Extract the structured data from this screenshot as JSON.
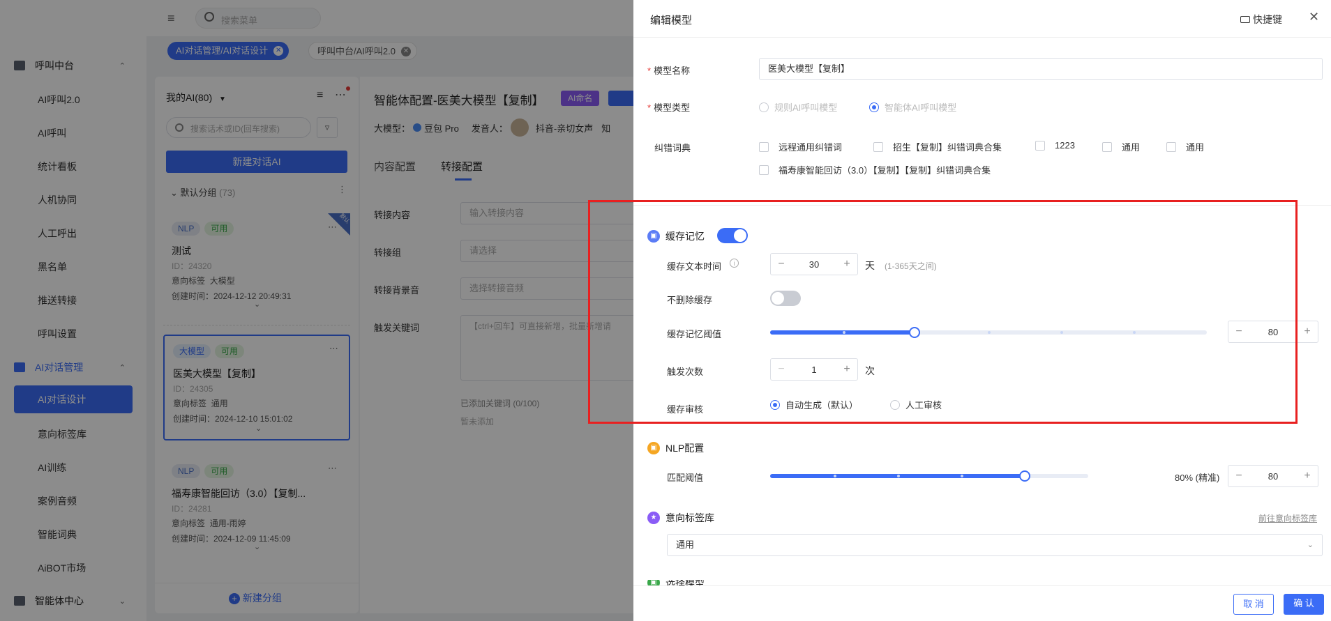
{
  "sidebar": {
    "groups": [
      {
        "label": "呼叫中台",
        "icon": "monitor-icon"
      },
      {
        "label": "AI对话管理",
        "icon": "document-icon"
      },
      {
        "label": "智能体中心",
        "icon": "layers-icon"
      }
    ],
    "items_call": [
      "AI呼叫2.0",
      "AI呼叫",
      "统计看板",
      "人机协同",
      "人工呼出",
      "黑名单",
      "推送转接",
      "呼叫设置"
    ],
    "items_ai": [
      "AI对话设计",
      "意向标签库",
      "AI训练",
      "案例音频",
      "智能词典",
      "AiBOT市场"
    ]
  },
  "topbar": {
    "search_placeholder": "搜索菜单",
    "tabs": [
      {
        "label": "AI对话管理/AI对话设计",
        "active": true
      },
      {
        "label": "呼叫中台/AI呼叫2.0",
        "active": false
      }
    ]
  },
  "list": {
    "title": "我的AI(80)",
    "search_placeholder": "搜索话术或ID(回车搜索)",
    "new_button": "新建对话AI",
    "group_name": "默认分组",
    "group_count": "(73)",
    "new_group": "新建分组",
    "corner_badge": "默认",
    "cards": [
      {
        "tags": [
          "NLP",
          "可用"
        ],
        "name": "测试",
        "id": "ID：24320",
        "intent_label": "意向标签",
        "intent": "大模型",
        "created": "创建时间：2024-12-12 20:49:31"
      },
      {
        "tags": [
          "大模型",
          "可用"
        ],
        "name": "医美大模型【复制】",
        "id": "ID：24305",
        "intent_label": "意向标签",
        "intent": "通用",
        "created": "创建时间：2024-12-10 15:01:02"
      },
      {
        "tags": [
          "NLP",
          "可用"
        ],
        "name": "福寿康智能回访（3.0）【复制...",
        "id": "ID：24281",
        "intent_label": "意向标签",
        "intent": "通用-雨婷",
        "created": "创建时间：2024-12-09 11:45:09"
      }
    ]
  },
  "main": {
    "title": "智能体配置-医美大模型【复制】",
    "badge": "AI命名",
    "model_label": "大模型：",
    "model_value": "豆包 Pro",
    "speaker_label": "发音人：",
    "speaker_value": "抖音-亲切女声",
    "know_label": "知",
    "tabs": [
      "内容配置",
      "转接配置"
    ],
    "fields": [
      {
        "label": "转接内容",
        "placeholder": "输入转接内容"
      },
      {
        "label": "转接组",
        "placeholder": "请选择"
      },
      {
        "label": "转接背景音",
        "placeholder": "选择转接音频"
      },
      {
        "label": "触发关键词",
        "placeholder": "【ctrl+回车】可直接新增，批量新增请"
      }
    ],
    "added_keywords": "已添加关键词 (0/100)",
    "none_added": "暂未添加"
  },
  "drawer": {
    "title": "编辑模型",
    "shortcut": "快捷键",
    "model_name_label": "模型名称",
    "model_name_value": "医美大模型【复制】",
    "model_type_label": "模型类型",
    "model_type_options": [
      "规则AI呼叫模型",
      "智能体AI呼叫模型"
    ],
    "dict_label": "纠错词典",
    "dict_options": [
      "远程通用纠错词",
      "招生【复制】纠错词典合集",
      "1223",
      "通用",
      "通用",
      "福寿康智能回访（3.0）【复制】【复制】纠错词典合集"
    ],
    "cache": {
      "title": "缓存记忆",
      "enabled": true,
      "text_time_label": "缓存文本时间",
      "text_time_value": "30",
      "text_time_unit": "天",
      "text_time_hint": "(1-365天之间)",
      "no_delete_label": "不删除缓存",
      "no_delete_enabled": false,
      "threshold_label": "缓存记忆阈值",
      "threshold_value": "80",
      "threshold_fraction": 0.33,
      "trigger_label": "触发次数",
      "trigger_value": "1",
      "trigger_unit": "次",
      "review_label": "缓存审核",
      "review_options": [
        "自动生成（默认）",
        "人工审核"
      ]
    },
    "nlp": {
      "title": "NLP配置",
      "match_label": "匹配阈值",
      "match_fraction": 0.8,
      "match_text": "80% (精准)",
      "match_value": "80"
    },
    "intent": {
      "title": "意向标签库",
      "link": "前往意向标签库",
      "value": "通用"
    },
    "next_section": "选择模型",
    "cancel": "取 消",
    "confirm": "确 认"
  },
  "colors": {
    "accent": "#3b6cf6",
    "highlight_box": "#e82020",
    "nlp_icon": "#f5a623",
    "cache_icon": "#5b7cf6",
    "intent_icon": "#8a5cf6"
  }
}
